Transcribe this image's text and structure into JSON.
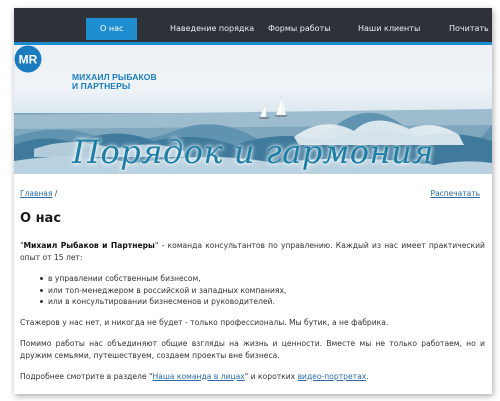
{
  "nav": {
    "items": [
      "О нас",
      "Наведение порядка",
      "Формы работы",
      "Наши клиенты",
      "Почитать"
    ],
    "active": "О нас"
  },
  "logo": {
    "badge": "MR",
    "line1": "МИХАИЛ РЫБАКОВ",
    "line2": "И ПАРТНЕРЫ"
  },
  "banner": {
    "tagline": "Порядок и гармония"
  },
  "breadcrumb": {
    "home": "Главная",
    "sep": "/"
  },
  "print_label": "Распечатать",
  "page_title": "О нас",
  "body": {
    "intro_open_quote": "\"",
    "intro_name": "Михаил Рыбаков и Партнеры",
    "intro_close_quote": "\"",
    "intro_rest": " - команда консультантов по управлению. Каждый из нас имеет практический опыт от 15 лет:",
    "list": [
      "в управлении собственным бизнесом,",
      "или топ-менеджером в российской и западных компаниях,",
      "или в консультировании бизнесменов и руководителей."
    ],
    "p2": "Стажеров у нас нет, и никогда не будет - только профессионалы. Мы бутик, а не фабрика.",
    "p3": "Помимо работы нас объединяют общие взгляды на жизнь и ценности. Вместе мы не только работаем, но и дружим семьями, путешествуем, создаем проекты вне бизнеса.",
    "p4_prefix": "Подробнее смотрите в разделе \"",
    "p4_link1": "Наша команда в лицах",
    "p4_mid": "\" и коротких ",
    "p4_link2": "видео-портретах",
    "p4_suffix": "."
  },
  "colors": {
    "nav_bg": "#2e3238",
    "accent": "#1e8ed0",
    "link": "#2b6aa8",
    "tagline": "#1e7fa6"
  }
}
